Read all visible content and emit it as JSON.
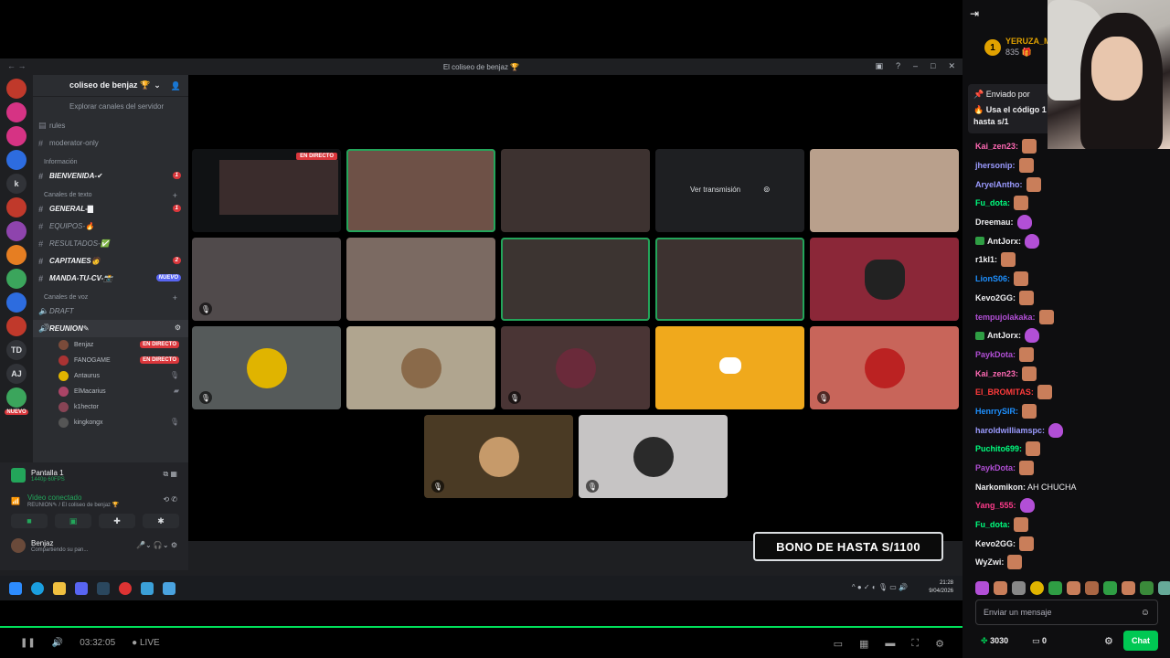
{
  "window": {
    "title": "El coliseo de benjaz 🏆"
  },
  "guild": {
    "name": "coliseo de benjaz 🏆",
    "browse": "Explorar canales del servidor"
  },
  "channels": [
    {
      "name": "rules",
      "bold": false
    },
    {
      "name": "moderator-only",
      "bold": false
    }
  ],
  "categories": {
    "info": "Información",
    "text": "Canales de texto",
    "voice": "Canales de voz"
  },
  "info_channels": [
    {
      "name": "BIENVENIDA-✔",
      "badge": "1"
    }
  ],
  "text_channels": [
    {
      "name": "GENERAL-▇",
      "badge": "1"
    },
    {
      "name": "EQUIPOS-🔥",
      "badge": ""
    },
    {
      "name": "RESULTADOS-✅",
      "badge": ""
    },
    {
      "name": "CAPITANES🧑",
      "badge": "2"
    },
    {
      "name": "MANDA-TU-CV-📸",
      "badge": "NUEVO"
    }
  ],
  "voice_channels": [
    {
      "name": "DRAFT"
    },
    {
      "name": "REUNION✎"
    }
  ],
  "voice_users": [
    {
      "name": "Benjaz",
      "status": "EN DIRECTO"
    },
    {
      "name": "FANOGAME",
      "status": "EN DIRECTO"
    },
    {
      "name": "Antaurus",
      "status": ""
    },
    {
      "name": "ElMacarius",
      "status": ""
    },
    {
      "name": "k1hector",
      "status": ""
    },
    {
      "name": "kingkongx",
      "status": ""
    }
  ],
  "server_icons": [
    "TD",
    "AJ"
  ],
  "server_new_badge": "NUEVO",
  "panel": {
    "screen_title": "Pantalla 1",
    "screen_sub": "1440p 60FPS",
    "video_status": "Video conectado",
    "video_sub": "REUNION✎ / El coliseo de benjaz 🏆",
    "username": "Benjaz",
    "user_sub": "Compartiendo su pan..."
  },
  "grid": {
    "live_tag": "EN DIRECTO",
    "view_stream": "Ver transmisión"
  },
  "taskbar": {
    "time": "21:28",
    "date": "9/04/2026"
  },
  "overlay": {
    "bono": "BONO DE HASTA S/1100"
  },
  "player": {
    "time": "03:32:05",
    "live": "LIVE"
  },
  "chat": {
    "streamer_rank": "1",
    "streamer_name": "YERUZA_M",
    "streamer_count": "835 🎁",
    "pinned_by": "Enviado por",
    "pinned_text": "🔥 Usa el código 1 bono de hasta s/1",
    "messages": [
      {
        "user": "Kai_zen23:",
        "color": "#ff69b4",
        "text": "",
        "emote": "face",
        "badge": false
      },
      {
        "user": "jhersonip:",
        "color": "#9b9bff",
        "text": "",
        "emote": "face",
        "badge": false
      },
      {
        "user": "AryelAntho:",
        "color": "#9b9bff",
        "text": "",
        "emote": "face",
        "badge": false
      },
      {
        "user": "Fu_dota:",
        "color": "#00ff7f",
        "text": "",
        "emote": "face",
        "badge": false
      },
      {
        "user": "Dreemau:",
        "color": "#efeff1",
        "text": "",
        "emote": "purple",
        "badge": false
      },
      {
        "user": "AntJorx:",
        "color": "#efeff1",
        "text": "",
        "emote": "purple",
        "badge": true
      },
      {
        "user": "r1kI1:",
        "color": "#efeff1",
        "text": "",
        "emote": "face",
        "badge": false
      },
      {
        "user": "LionS06:",
        "color": "#1e90ff",
        "text": "",
        "emote": "face",
        "badge": false
      },
      {
        "user": "Kevo2GG:",
        "color": "#efeff1",
        "text": "",
        "emote": "face",
        "badge": false
      },
      {
        "user": "tempujolakaka:",
        "color": "#b24fd6",
        "text": "",
        "emote": "face",
        "badge": false
      },
      {
        "user": "AntJorx:",
        "color": "#efeff1",
        "text": "",
        "emote": "purple",
        "badge": true
      },
      {
        "user": "PaykDota:",
        "color": "#b24fd6",
        "text": "",
        "emote": "face",
        "badge": false
      },
      {
        "user": "Kai_zen23:",
        "color": "#ff69b4",
        "text": "",
        "emote": "face",
        "badge": false
      },
      {
        "user": "El_BROMITAS:",
        "color": "#ff3b3b",
        "text": "",
        "emote": "face",
        "badge": false
      },
      {
        "user": "HenrrySIR:",
        "color": "#1e90ff",
        "text": "",
        "emote": "face",
        "badge": false
      },
      {
        "user": "haroldwilliamspc:",
        "color": "#9b9bff",
        "text": "",
        "emote": "purple",
        "badge": false
      },
      {
        "user": "Puchito699:",
        "color": "#00ff7f",
        "text": "",
        "emote": "face",
        "badge": false
      },
      {
        "user": "PaykDota:",
        "color": "#b24fd6",
        "text": "",
        "emote": "face",
        "badge": false
      },
      {
        "user": "Narkomikon:",
        "color": "#efeff1",
        "text": "AH CHUCHA",
        "emote": "",
        "badge": false
      },
      {
        "user": "Yang_555:",
        "color": "#ff3b8b",
        "text": "",
        "emote": "purple",
        "badge": false
      },
      {
        "user": "Fu_dota:",
        "color": "#00ff7f",
        "text": "",
        "emote": "face",
        "badge": false
      },
      {
        "user": "Kevo2GG:",
        "color": "#efeff1",
        "text": "",
        "emote": "face",
        "badge": false
      },
      {
        "user": "WyZwi:",
        "color": "#efeff1",
        "text": "",
        "emote": "face",
        "badge": false
      }
    ],
    "input_placeholder": "Enviar un mensaje",
    "points": "3030",
    "points2": "0",
    "chat_button": "Chat"
  }
}
